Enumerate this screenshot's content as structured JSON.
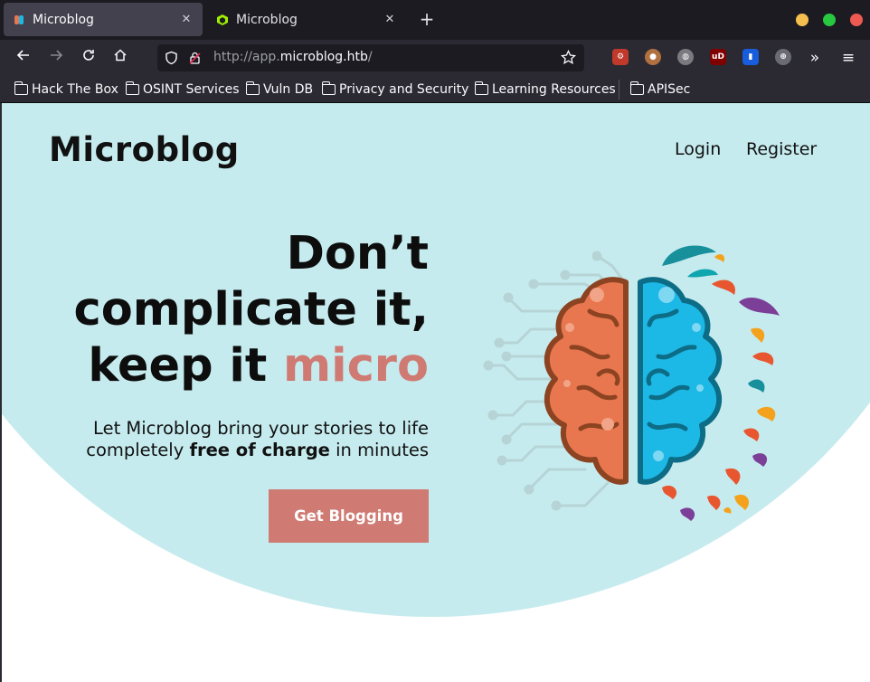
{
  "browser": {
    "tabs": [
      {
        "title": "Microblog",
        "active": true
      },
      {
        "title": "Microblog",
        "active": false
      }
    ],
    "url_prefix": "http://app.",
    "url_host": "microblog.htb",
    "url_suffix": "/",
    "bookmarks": [
      "Hack The Box",
      "OSINT Services",
      "Vuln DB",
      "Privacy and Security",
      "Learning Resources",
      "APISec"
    ],
    "window_buttons": {
      "minimize": "#f5bf4f",
      "maximize": "#28c840",
      "close": "#ee5a52"
    }
  },
  "site": {
    "logo": "Microblog",
    "nav": {
      "login": "Login",
      "register": "Register"
    },
    "headline_line1": "Don’t",
    "headline_line2": "complicate it,",
    "headline_line3_prefix": "keep it ",
    "headline_line3_accent": "micro",
    "subtext_line1": "Let Microblog bring your stories to life",
    "subtext_line2_prefix": "completely ",
    "subtext_line2_bold": "free of charge",
    "subtext_line2_suffix": " in minutes",
    "cta": "Get Blogging",
    "colors": {
      "hero_bg": "#c6ebee",
      "accent": "#cf7a72",
      "brain_left": "#e8774f",
      "brain_right": "#1cb8e6"
    }
  }
}
